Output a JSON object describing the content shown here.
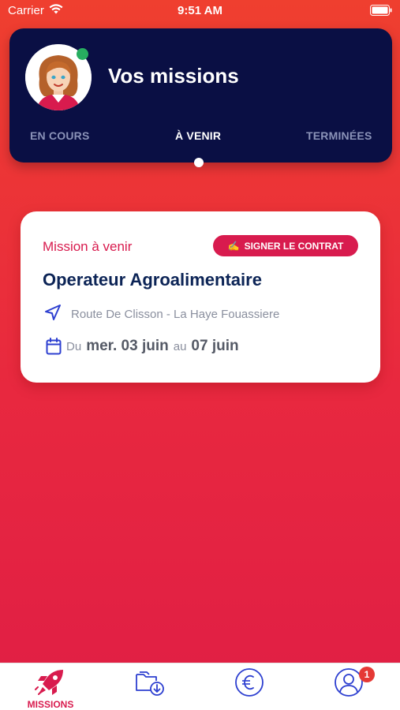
{
  "status_bar": {
    "carrier": "Carrier",
    "time": "9:51 AM"
  },
  "header": {
    "title": "Vos missions",
    "online_color": "#27ae60",
    "tabs": [
      {
        "label": "EN COURS",
        "active": false
      },
      {
        "label": "À VENIR",
        "active": true
      },
      {
        "label": "TERMINÉES",
        "active": false
      }
    ]
  },
  "mission": {
    "status": "Mission à venir",
    "sign_button": {
      "emoji": "✍",
      "label": "SIGNER LE CONTRAT"
    },
    "title": "Operateur Agroalimentaire",
    "address": "Route De Clisson - La Haye Fouassiere",
    "dates": {
      "prefix": "Du",
      "start": "mer. 03 juin",
      "connector": "au",
      "end": "07 juin"
    }
  },
  "nav": {
    "items": [
      {
        "label": "MISSIONS",
        "icon": "rocket-icon",
        "active": true
      },
      {
        "label": "",
        "icon": "folder-download-icon",
        "active": false
      },
      {
        "label": "",
        "icon": "euro-icon",
        "active": false
      },
      {
        "label": "",
        "icon": "profile-icon",
        "active": false,
        "badge": "1"
      }
    ]
  },
  "colors": {
    "accent": "#d81b4e",
    "header_bg": "#0a0f44",
    "bg_top": "#ef3f2f",
    "bg_bottom": "#e01e45",
    "icon_blue": "#2d3fd0"
  }
}
